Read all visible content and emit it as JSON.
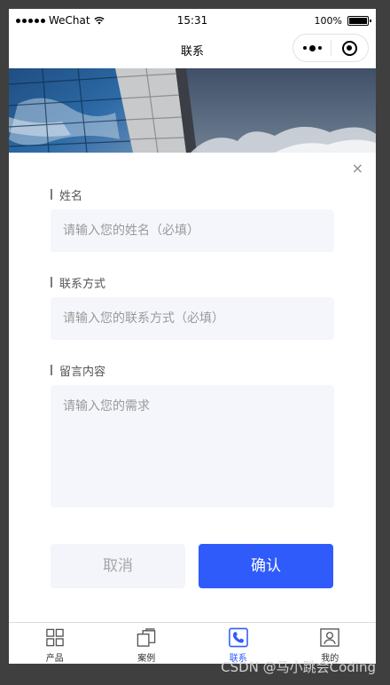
{
  "status_bar": {
    "carrier": "WeChat",
    "time": "15:31",
    "battery": "100%"
  },
  "nav": {
    "title": "联系"
  },
  "form": {
    "name": {
      "label": "姓名",
      "placeholder": "请输入您的姓名（必填）"
    },
    "contact": {
      "label": "联系方式",
      "placeholder": "请输入您的联系方式（必填）"
    },
    "message": {
      "label": "留言内容",
      "placeholder": "请输入您的需求"
    },
    "cancel_label": "取消",
    "confirm_label": "确认",
    "close_symbol": "×"
  },
  "tab_bar": {
    "items": [
      {
        "label": "产品",
        "icon": "grid-icon"
      },
      {
        "label": "案例",
        "icon": "case-icon"
      },
      {
        "label": "联系",
        "icon": "phone-icon",
        "active": true
      },
      {
        "label": "我的",
        "icon": "user-icon"
      }
    ]
  },
  "colors": {
    "accent": "#2f5bfb",
    "input_bg": "#f5f6fc"
  },
  "watermark": "CSDN @马小跳会Coding"
}
